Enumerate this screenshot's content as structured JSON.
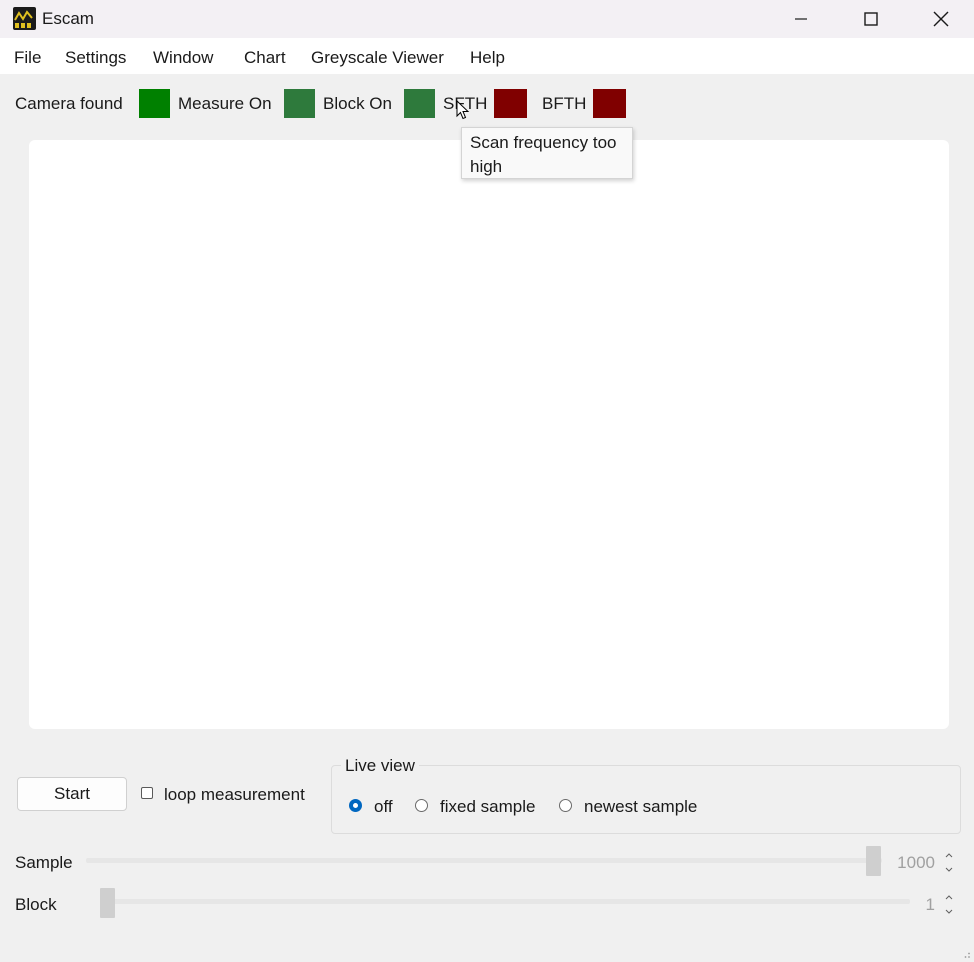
{
  "window": {
    "title": "Escam",
    "icon": "escam-app-icon"
  },
  "menubar": {
    "items": [
      "File",
      "Settings",
      "Window",
      "Chart",
      "Greyscale Viewer",
      "Help"
    ]
  },
  "status": {
    "indicators": [
      {
        "label": "Camera found",
        "color": "#008000"
      },
      {
        "label": "Measure On",
        "color": "#2e7a3c"
      },
      {
        "label": "Block On",
        "color": "#2e7a3c"
      },
      {
        "label": "SFTH",
        "color": "#800000"
      },
      {
        "label": "BFTH",
        "color": "#800000"
      }
    ],
    "tooltip": "Scan frequency too high"
  },
  "controls": {
    "start_label": "Start",
    "loop_label": "loop measurement",
    "loop_checked": false
  },
  "live_view": {
    "title": "Live view",
    "options": [
      "off",
      "fixed sample",
      "newest sample"
    ],
    "selected": "off"
  },
  "sample": {
    "label": "Sample",
    "value": "1000"
  },
  "block": {
    "label": "Block",
    "value": "1"
  },
  "colors": {
    "accent": "#0067c0",
    "canvas": "#ffffff",
    "background": "#f0f0f0"
  }
}
